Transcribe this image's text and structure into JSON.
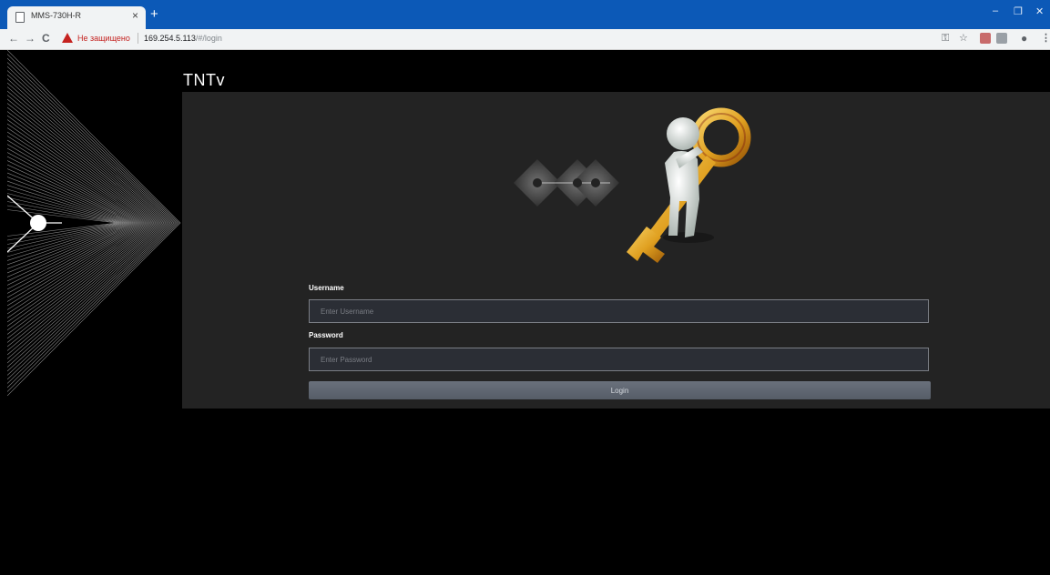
{
  "browser": {
    "tab_title": "MMS-730H-R",
    "security_warning": "Не защищено",
    "url_host": "169.254.5.113",
    "url_path": "/#/login"
  },
  "app": {
    "brand": "TNTv"
  },
  "login": {
    "username_label": "Username",
    "username_placeholder": "Enter Username",
    "password_label": "Password",
    "password_placeholder": "Enter Password",
    "login_button": "Login"
  },
  "colors": {
    "titlebar": "#0c59b7",
    "panel": "#232323",
    "input_bg": "#2b2e35",
    "button": "#5f6670",
    "warning": "#c5221f"
  },
  "icons": [
    "page-icon",
    "close-icon",
    "plus-icon",
    "minimize-icon",
    "restore-icon",
    "back-arrow-icon",
    "forward-arrow-icon",
    "reload-icon",
    "warning-icon",
    "key-icon",
    "star-icon",
    "extension-icon",
    "profile-icon",
    "menu-icon",
    "key-figure-illustration"
  ]
}
